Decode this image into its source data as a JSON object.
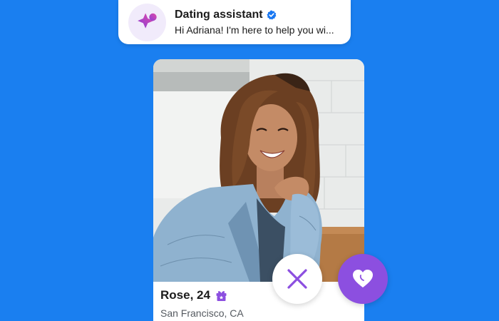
{
  "assistant": {
    "title": "Dating assistant",
    "message": "Hi Adriana! I'm here to help you wi...",
    "accent_color": "#a94fd6",
    "icon": "sparkle-icon",
    "verified_icon": "verified-badge-icon"
  },
  "profile": {
    "name_age": "Rose, 24",
    "location": "San Francisco, CA",
    "badge_icon": "gift-icon",
    "photo": "profile-photo"
  },
  "actions": {
    "dislike_icon": "close-icon",
    "like_icon": "heart-icon",
    "like_color": "#8c4fe0",
    "dislike_color": "#8c4fe0"
  },
  "colors": {
    "background": "#1a7ff0",
    "card": "#ffffff"
  }
}
